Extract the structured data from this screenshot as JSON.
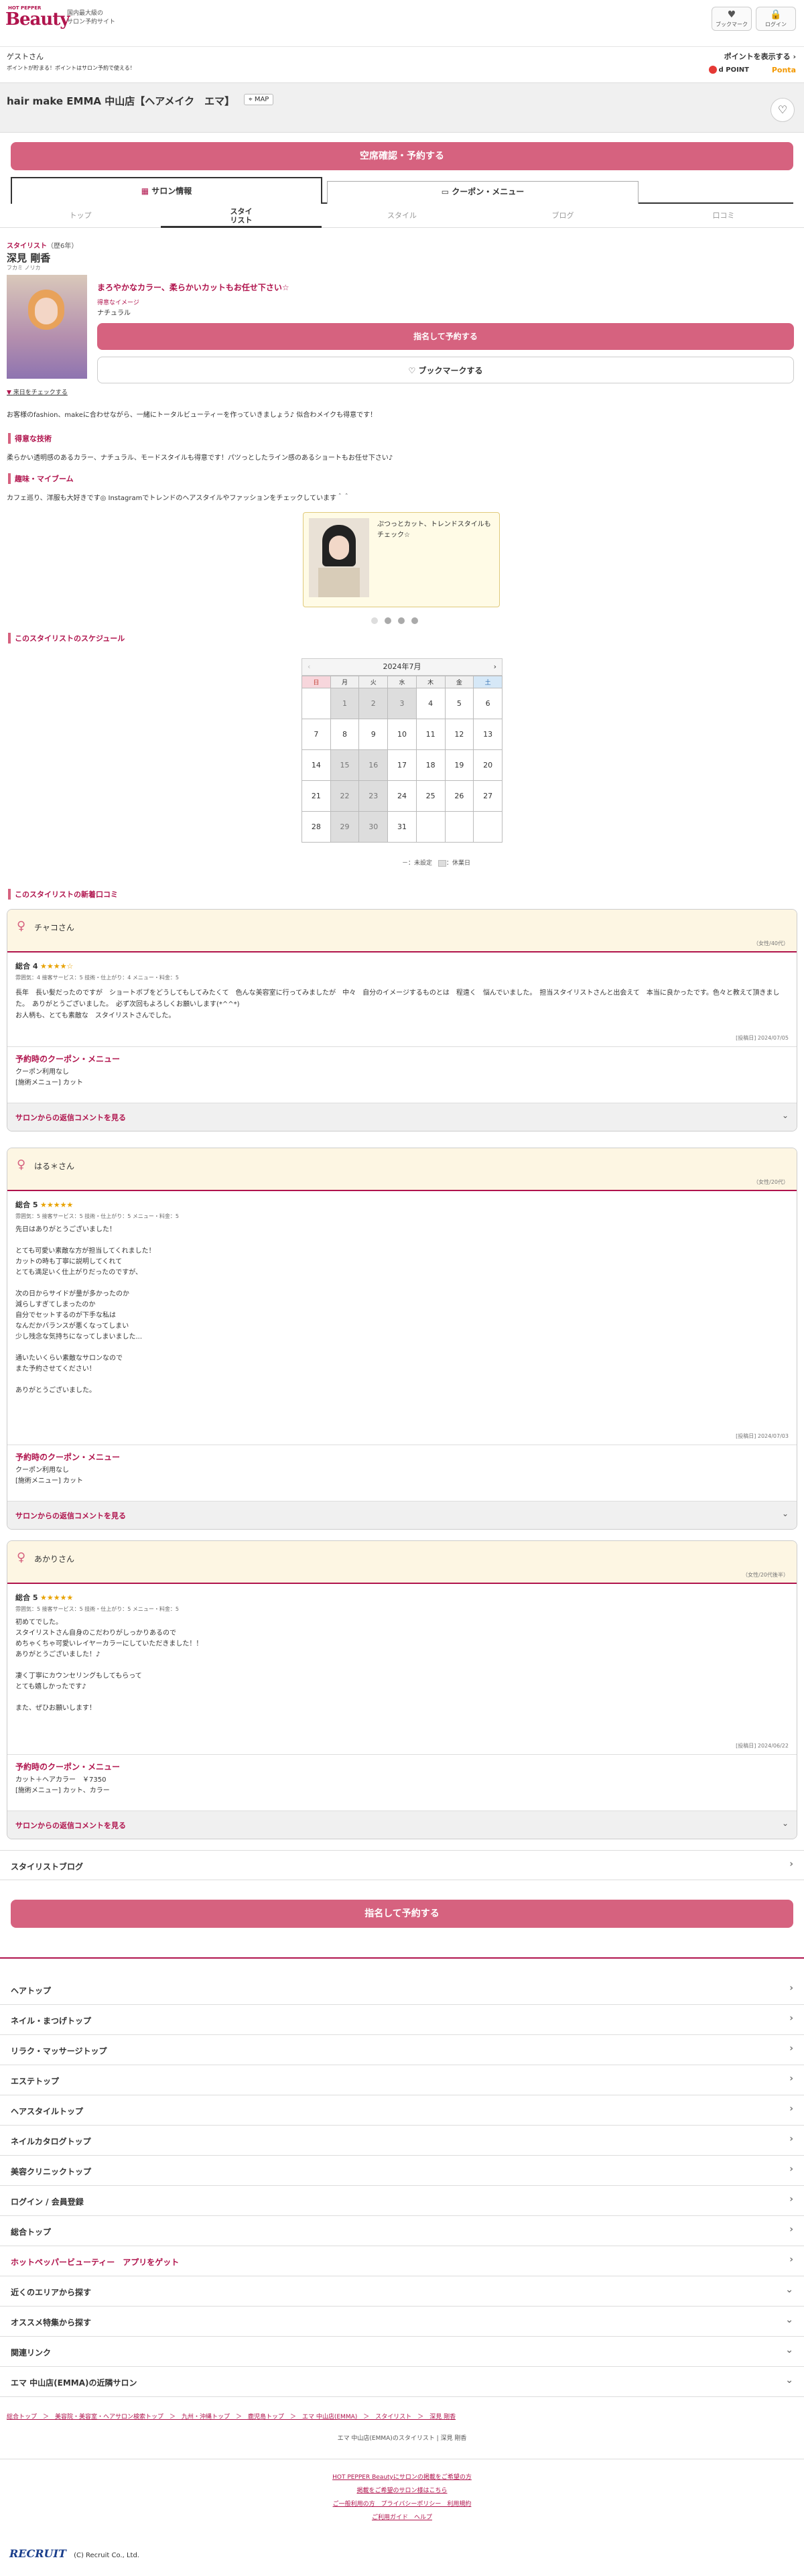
{
  "header": {
    "logo_small": "HOT PEPPER",
    "logo_big": "Beauty",
    "tagline": "国内最大級の\nサロン予約サイト",
    "bookmark": "ブックマーク",
    "login": "ログイン"
  },
  "guest": {
    "name": "ゲストさん",
    "note": "ポイントが貯まる！ポイントはサロン予約で使える！",
    "points": "ポイントを表示する",
    "dpoint": "d POINT",
    "ponta": "Ponta"
  },
  "salon": {
    "name": "hair make EMMA 中山店【ヘアメイク　エマ】",
    "map": "MAP"
  },
  "cta": {
    "reserve": "空席確認・予約する",
    "stylist_reserve": "指名して予約する",
    "bookmark": "ブックマークする"
  },
  "tabs": [
    {
      "label": "サロン情報"
    },
    {
      "label": "クーポン・メニュー"
    }
  ],
  "subtabs": [
    {
      "label": "トップ"
    },
    {
      "label": "スタイ\nリスト"
    },
    {
      "label": "スタイル"
    },
    {
      "label": "ブログ"
    },
    {
      "label": "口コミ"
    }
  ],
  "stylist": {
    "role": "スタイリスト",
    "years": "（歴6年）",
    "name": "深見 剛香",
    "kana": "フカミ ノリカ",
    "catch": "まろやかなカラー、柔らかいカットもお任せ下さい☆",
    "image_label": "得意なイメージ",
    "image_value": "ナチュラル",
    "history_link": "来日をチェックする",
    "intro": "お客様のfashion、makeに合わせながら、一緒にトータルビューティーを作っていきましょう♪ 似合わメイクも得意です！"
  },
  "skill": {
    "title": "得意な技術",
    "text": "柔らかい透明感のあるカラー、ナチュラル、モードスタイルも得意です！パツっとしたライン感のあるショートもお任せ下さい♪"
  },
  "hobby": {
    "title": "趣味・マイブーム",
    "text": "カフェ巡り、洋服も大好きです◎ Instagramでトレンドのヘアスタイルやファッションをチェックしています＾＾"
  },
  "style_card": {
    "caption": "ぷつっとカット、トレンドスタイルもチェック☆"
  },
  "schedule": {
    "title": "このスタイリストのスケジュール",
    "month": "2024年7月",
    "weekdays": [
      "日",
      "月",
      "火",
      "水",
      "木",
      "金",
      "土"
    ],
    "days": [
      [
        "",
        "1",
        "2",
        "3",
        "4",
        "5",
        "6"
      ],
      [
        "7",
        "8",
        "9",
        "10",
        "11",
        "12",
        "13"
      ],
      [
        "14",
        "15",
        "16",
        "17",
        "18",
        "19",
        "20"
      ],
      [
        "21",
        "22",
        "23",
        "24",
        "25",
        "26",
        "27"
      ],
      [
        "28",
        "29",
        "30",
        "31",
        "",
        "",
        ""
      ]
    ],
    "legend_undecided": "－：未設定",
    "legend_closed": "：休業日"
  },
  "reviews_title": "このスタイリストの新着口コミ",
  "reviews": [
    {
      "name": "チャコさん",
      "age": "（女性/40代）",
      "score": "総合 4",
      "stars": "★★★★☆",
      "sub": "雰囲気：4 接客サービス：5 技術・仕上がり：4 メニュー・料金：5",
      "text": "長年　長い髪だったのですが　ショートボブをどうしてもしてみたくて　色んな美容室に行ってみましたが　中々　自分のイメージするものとは　程遠く　悩んでいました。　担当スタイリストさんと出会えて　本当に良かったです。色々と教えて頂きました。　ありがとうございました。　必ず次回もよろしくお願いします(*^^*)\nお人柄も、とても素敵な　スタイリストさんでした。",
      "date": "[投稿日] 2024/07/05",
      "coupon_title": "予約時のクーポン・メニュー",
      "coupon": "クーポン利用なし\n[施術メニュー] カット",
      "reply": "サロンからの返信コメントを見る"
    },
    {
      "name": "はる＊さん",
      "age": "（女性/20代）",
      "score": "総合 5",
      "stars": "★★★★★",
      "sub": "雰囲気：5 接客サービス：5 技術・仕上がり：5 メニュー・料金：5",
      "text": "先日はありがとうございました！\n\nとても可愛い素敵な方が担当してくれました！\nカットの時も丁寧に説明してくれて\nとても満足いく仕上がりだったのですが、\n\n次の日からサイドが量が多かったのか\n減らしすぎてしまったのか\n自分でセットするのが下手な私は\nなんだかバランスが悪くなってしまい\n少し残念な気持ちになってしまいました...\n\n通いたいくらい素敵なサロンなので\nまた予約させてください！\n\nありがとうございました。",
      "date": "[投稿日] 2024/07/03",
      "coupon_title": "予約時のクーポン・メニュー",
      "coupon": "クーポン利用なし\n[施術メニュー] カット",
      "reply": "サロンからの返信コメントを見る"
    },
    {
      "name": "あかりさん",
      "age": "（女性/20代後半）",
      "score": "総合 5",
      "stars": "★★★★★",
      "sub": "雰囲気：5 接客サービス：5 技術・仕上がり：5 メニュー・料金：5",
      "text": "初めてでした。\nスタイリストさん自身のこだわりがしっかりあるので\nめちゃくちゃ可愛いレイヤーカラーにしていただきました！！\nありがとうございました！♪\n\n凄く丁寧にカウンセリングもしてもらって\nとても嬉しかったです♪\n\nまた、ぜひお願いします！",
      "date": "[投稿日] 2024/06/22",
      "coupon_title": "予約時のクーポン・メニュー",
      "coupon": "カット＋ヘアカラー　￥7350\n[施術メニュー] カット、カラー",
      "reply": "サロンからの返信コメントを見る"
    }
  ],
  "blog": "スタイリストブログ",
  "nav": [
    {
      "label": "ヘアトップ"
    },
    {
      "label": "ネイル・まつげトップ"
    },
    {
      "label": "リラク・マッサージトップ"
    },
    {
      "label": "エステトップ"
    },
    {
      "label": "ヘアスタイルトップ"
    },
    {
      "label": "ネイルカタログトップ"
    },
    {
      "label": "美容クリニックトップ"
    },
    {
      "label": "ログイン / 会員登録"
    },
    {
      "label": "総合トップ"
    },
    {
      "label": "ホットペッパービューティー　アプリをゲット"
    },
    {
      "label": "近くのエリアから探す"
    },
    {
      "label": "オススメ特集から探す"
    },
    {
      "label": "関連リンク"
    },
    {
      "label": "エマ 中山店(EMMA)の近隣サロン"
    }
  ],
  "breadcrumb": "総合トップ　＞　美容院・美容室・ヘアサロン検索トップ　＞　九州・沖縄トップ　＞　鹿児島トップ　＞　エマ 中山店(EMMA)　＞　スタイリスト　＞　深見 剛香",
  "footer_line": "エマ 中山店(EMMA)のスタイリスト | 深見 剛香",
  "footer_links": [
    "HOT PEPPER Beautyにサロンの掲載をご希望の方",
    "掲載をご希望のサロン様はこちら",
    "ご一般利用の方　プライバシーポリシー　利用規約",
    "ご利用ガイド　ヘルプ"
  ],
  "copyright": "(C) Recruit Co., Ltd.",
  "recruit": "RECRUIT",
  "colors": {
    "accent": "#b0144d",
    "button": "#d6627f"
  }
}
